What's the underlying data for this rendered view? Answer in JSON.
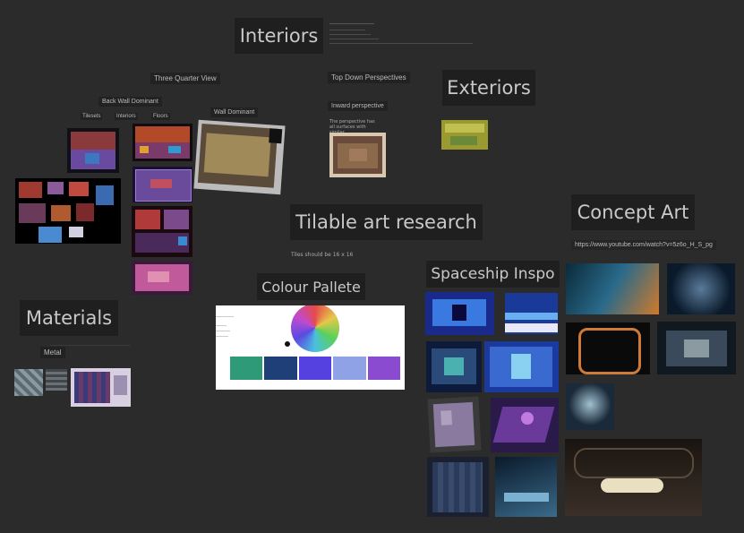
{
  "board": {
    "headings": {
      "interiors": "Interiors",
      "exteriors": "Exteriors",
      "tilable": "Tilable art research",
      "concept": "Concept Art",
      "colour": "Colour Pallete",
      "spaceship": "Spaceship Inspo",
      "materials": "Materials"
    },
    "labels": {
      "three_quarter": "Three Quarter View",
      "top_down": "Top Down Perspectives",
      "back_wall": "Back Wall Dominant",
      "wall_dominant": "Wall Dominant",
      "inward": "Inward perspective",
      "metal": "Metal",
      "sub1": "Tilesets",
      "sub2": "Interiors",
      "sub3": "Floors"
    },
    "notes": {
      "tiles": "Tiles should be 16 x 16",
      "youtube": "https://www.youtube.com/watch?v=5z6o_H_S_pg",
      "inward_note": "The perspective has all surfaces with similar"
    }
  },
  "palette": {
    "colors": [
      "#2e9a77",
      "#1f3f79",
      "#5540e0",
      "#8fa2e6",
      "#8a4bd0"
    ]
  },
  "colors": {
    "bg": "#2b2b2b",
    "heading_bg": "#1f1f1f"
  }
}
